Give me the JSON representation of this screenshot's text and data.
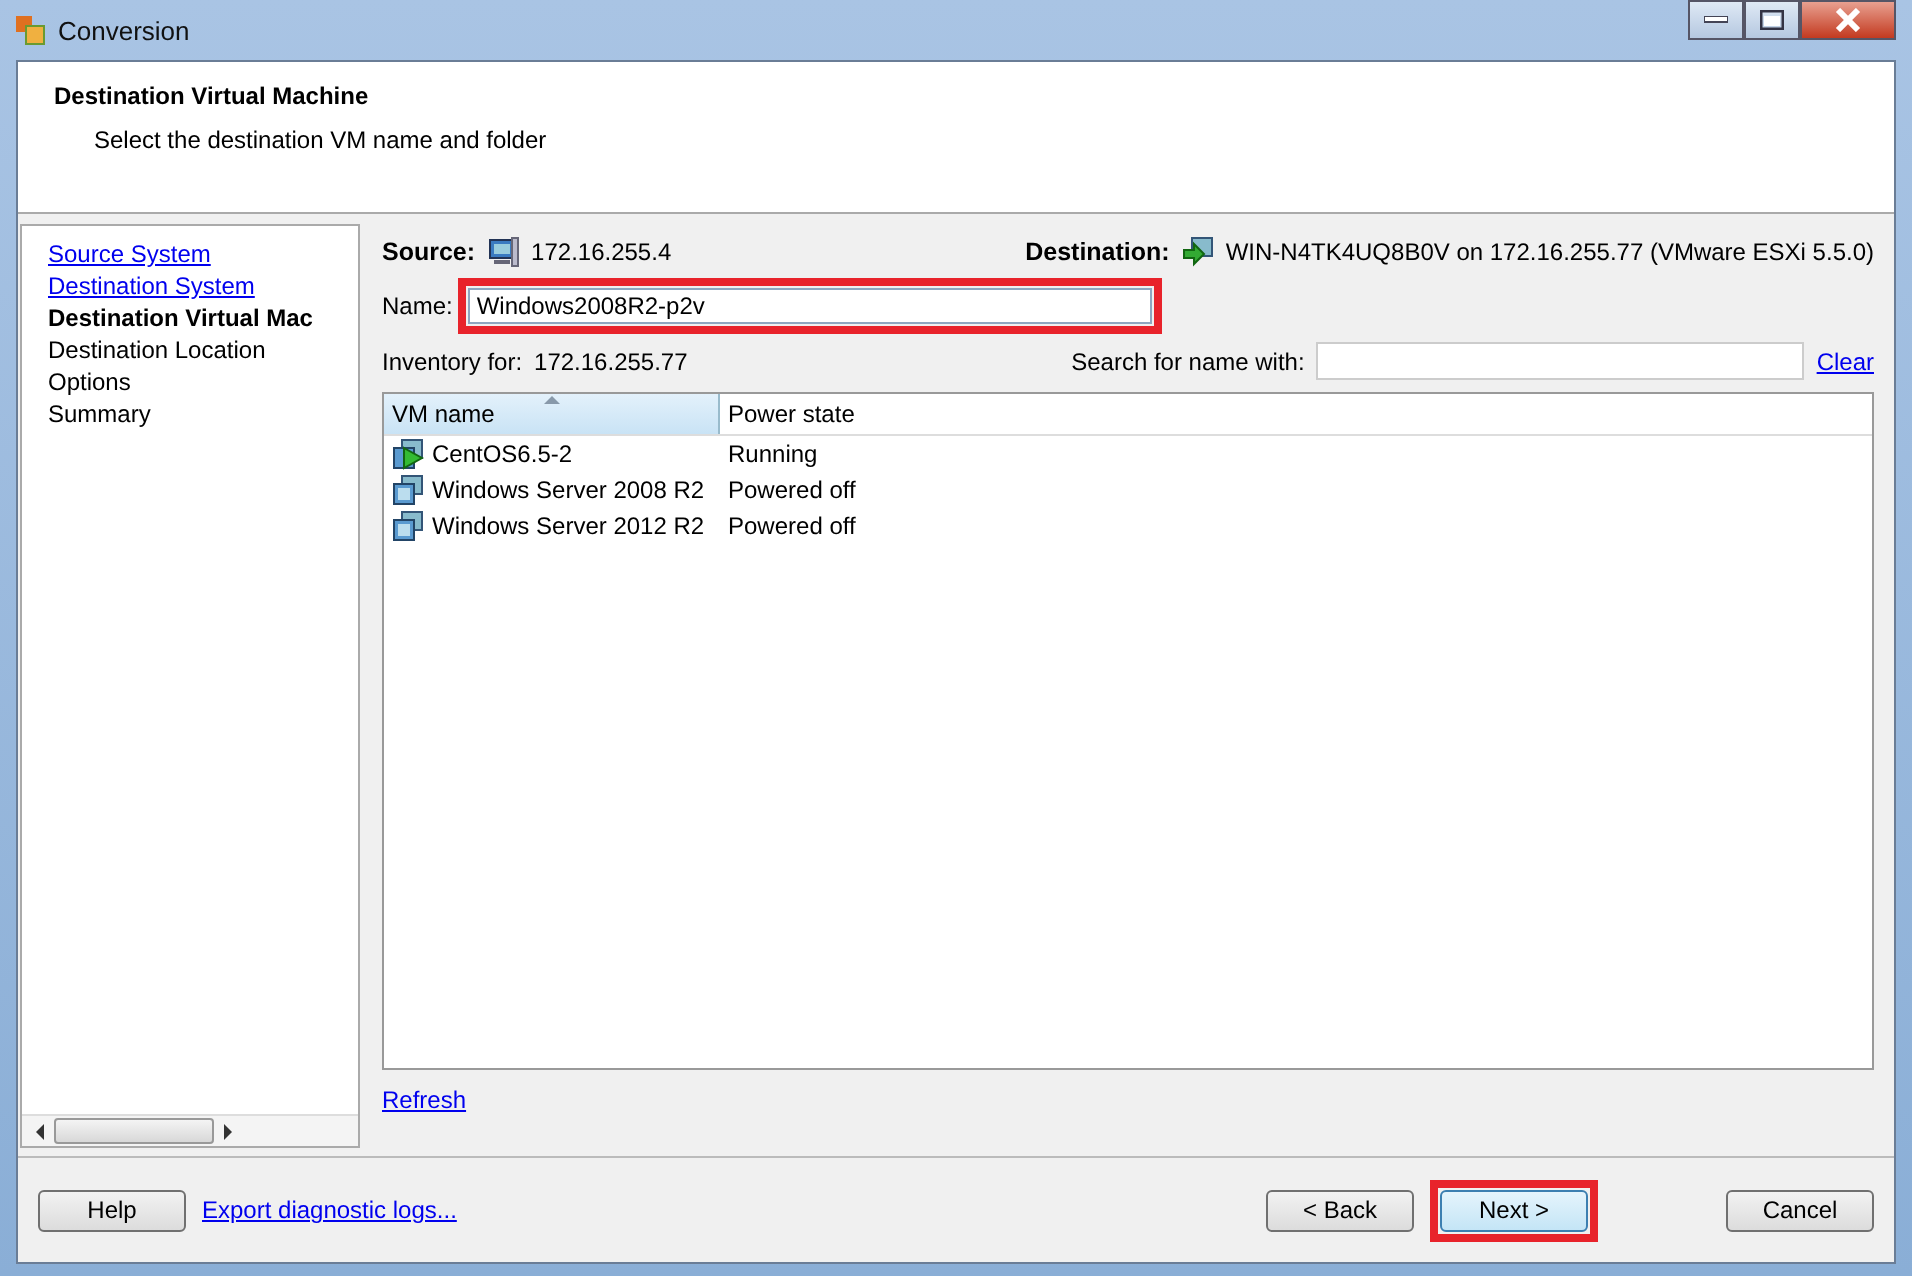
{
  "window": {
    "title": "Conversion"
  },
  "header": {
    "title": "Destination Virtual Machine",
    "subtitle": "Select the destination VM name and folder"
  },
  "sidebar": {
    "items": [
      {
        "label": "Source System",
        "kind": "link"
      },
      {
        "label": "Destination System",
        "kind": "link"
      },
      {
        "label": "Destination Virtual Mac",
        "kind": "current"
      },
      {
        "label": "Destination Location",
        "kind": "plain"
      },
      {
        "label": "Options",
        "kind": "plain"
      },
      {
        "label": "Summary",
        "kind": "plain"
      }
    ]
  },
  "source": {
    "label": "Source:",
    "value": "172.16.255.4"
  },
  "destination": {
    "label": "Destination:",
    "value": "WIN-N4TK4UQ8B0V on 172.16.255.77 (VMware ESXi 5.5.0)"
  },
  "name_field": {
    "label": "Name:",
    "value": "Windows2008R2-p2v",
    "highlighted": true
  },
  "inventory": {
    "label": "Inventory for:",
    "value": "172.16.255.77"
  },
  "search": {
    "label": "Search for name with:",
    "clear": "Clear"
  },
  "table": {
    "columns": [
      "VM name",
      "Power state"
    ],
    "rows": [
      {
        "name": "CentOS6.5-2",
        "state": "Running",
        "kind": "running"
      },
      {
        "name": "Windows Server 2008 R2",
        "state": "Powered off",
        "kind": "off"
      },
      {
        "name": "Windows Server 2012 R2",
        "state": "Powered off",
        "kind": "off"
      }
    ]
  },
  "refresh": "Refresh",
  "footer": {
    "help": "Help",
    "export": "Export diagnostic logs...",
    "back": "< Back",
    "next": {
      "label": "Next >",
      "highlighted": true
    },
    "cancel": "Cancel"
  }
}
